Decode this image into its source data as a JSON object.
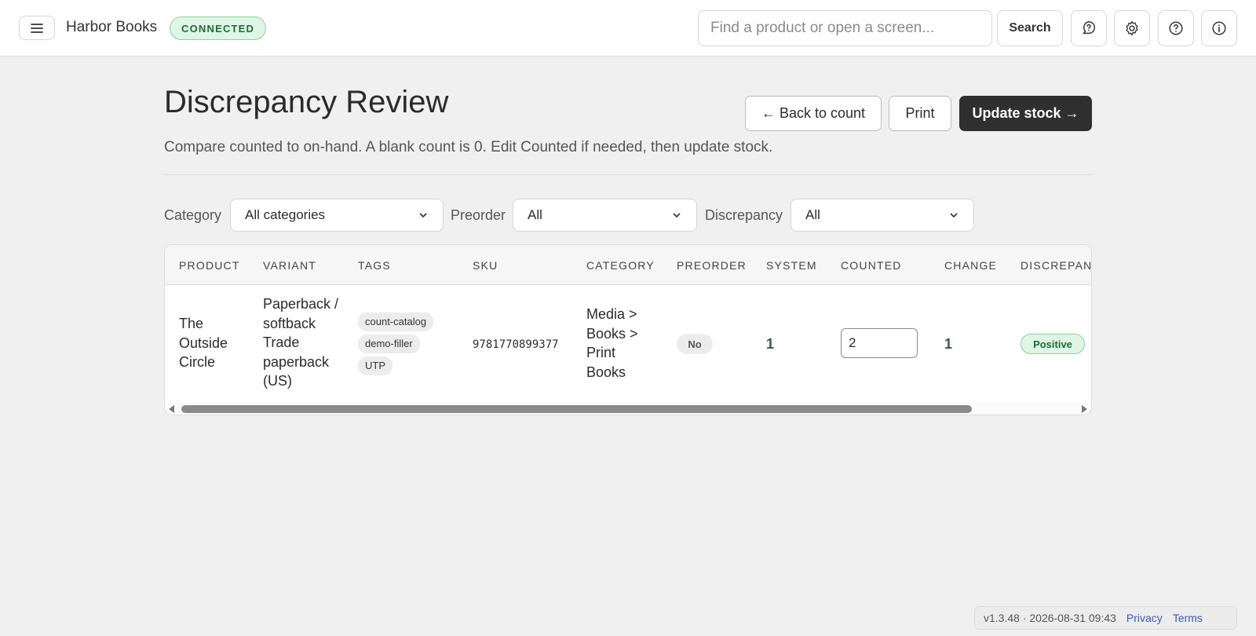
{
  "app": {
    "name": "Harbor Books",
    "status": "CONNECTED"
  },
  "topbar": {
    "search_placeholder": "Find a product or open a screen...",
    "search_label": "Search",
    "icons": [
      "menu-icon",
      "help-chat-icon",
      "gear-icon",
      "help-circle-icon",
      "info-icon"
    ]
  },
  "page": {
    "title": "Discrepancy Review",
    "subtitle": "Compare counted to on-hand. A blank count is 0. Edit Counted if needed, then update stock.",
    "actions": {
      "back": "← Back to count",
      "print": "Print",
      "update": "Update stock →"
    }
  },
  "filters": {
    "category": {
      "label": "Category",
      "value": "All categories"
    },
    "preorder": {
      "label": "Preorder",
      "value": "All"
    },
    "discrepancy": {
      "label": "Discrepancy",
      "value": "All"
    }
  },
  "table": {
    "columns": [
      "PRODUCT",
      "VARIANT",
      "TAGS",
      "SKU",
      "CATEGORY",
      "PREORDER",
      "SYSTEM",
      "COUNTED",
      "CHANGE",
      "DISCREPANCY"
    ],
    "rows": [
      {
        "product": "The Outside Circle",
        "variant": "Paperback / softback Trade paperback (US)",
        "tags": [
          "count-catalog",
          "demo-filler",
          "UTP"
        ],
        "sku": "9781770899377",
        "category": "Media > Books > Print Books",
        "preorder": "No",
        "system": "1",
        "counted": "2",
        "change": "1",
        "discrepancy": "Positive"
      }
    ]
  },
  "footer": {
    "version": "v1.3.48 · 2026-08-31 09:43",
    "privacy": "Privacy",
    "terms": "Terms"
  },
  "colors": {
    "accent_dark": "#2f2f2f",
    "success_bg": "#dff5e5",
    "success_text": "#1f6b37",
    "link": "#3b5bb5"
  }
}
